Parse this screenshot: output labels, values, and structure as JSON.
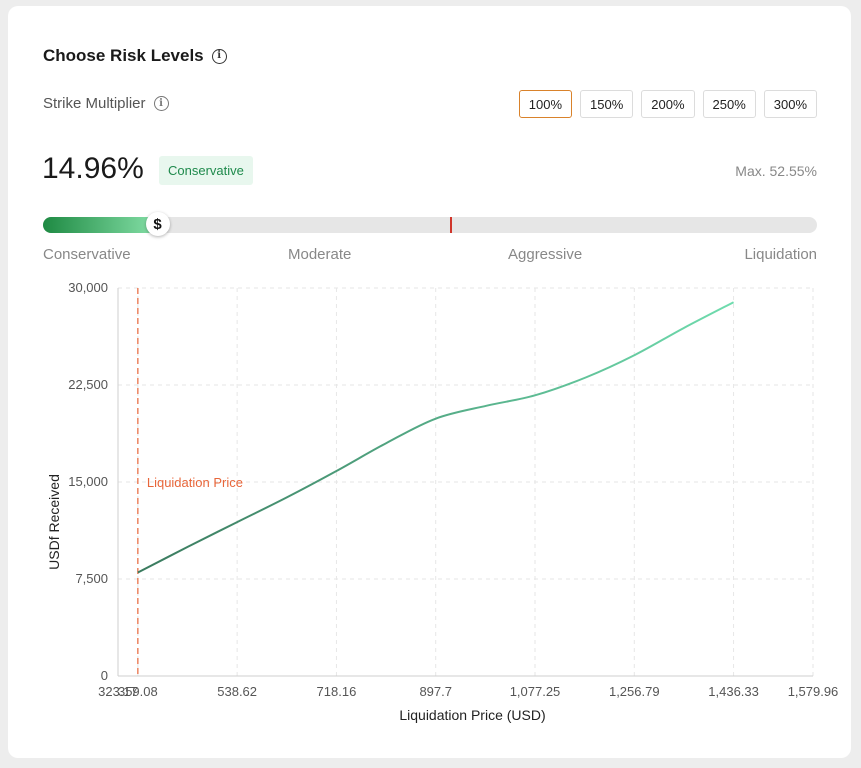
{
  "header": {
    "title": "Choose Risk Levels",
    "title_icon": "info-icon"
  },
  "multiplier": {
    "label": "Strike Multiplier",
    "icon": "info-icon",
    "options": [
      "100%",
      "150%",
      "200%",
      "250%",
      "300%"
    ],
    "selected": "100%"
  },
  "risk": {
    "value": "14.96%",
    "level": "Conservative",
    "max_text": "Max. 52.55%",
    "slider_fraction": 0.148,
    "liquidation_marker_fraction": 0.526,
    "thumb_symbol": "$",
    "levels": [
      "Conservative",
      "Moderate",
      "Aggressive",
      "Liquidation"
    ]
  },
  "colors": {
    "accent": "#d9822b",
    "badge_bg": "#e8f7ee",
    "badge_text": "#1f8a4c",
    "line_start": "#3a7a5e",
    "line_end": "#6fdcae",
    "liquidation_line": "#e8663a"
  },
  "chart_data": {
    "type": "line",
    "xlabel": "Liquidation Price (USD)",
    "ylabel": "USDf Received",
    "x_ticks": [
      "323.17",
      "359.08",
      "538.62",
      "718.16",
      "897.7",
      "1,077.25",
      "1,256.79",
      "1,436.33",
      "1,579.96"
    ],
    "x_tick_values": [
      323.17,
      359.08,
      538.62,
      718.16,
      897.7,
      1077.25,
      1256.79,
      1436.33,
      1579.96
    ],
    "y_ticks": [
      "0",
      "7,500",
      "15,000",
      "22,500",
      "30,000"
    ],
    "y_tick_values": [
      0,
      7500,
      15000,
      22500,
      30000
    ],
    "xlim": [
      323.17,
      1579.96
    ],
    "ylim": [
      0,
      30000
    ],
    "grid": true,
    "annotation": {
      "label": "Liquidation Price",
      "x": 359.08
    },
    "series": [
      {
        "x": [
          359.08,
          450,
          538.62,
          628,
          718.16,
          808,
          897.7,
          990,
          1077.25,
          1170,
          1256.79,
          1346,
          1436.33
        ],
        "y": [
          8000,
          10000,
          11900,
          13800,
          15850,
          18000,
          19900,
          20900,
          21700,
          23100,
          24800,
          26900,
          28900
        ]
      }
    ]
  }
}
